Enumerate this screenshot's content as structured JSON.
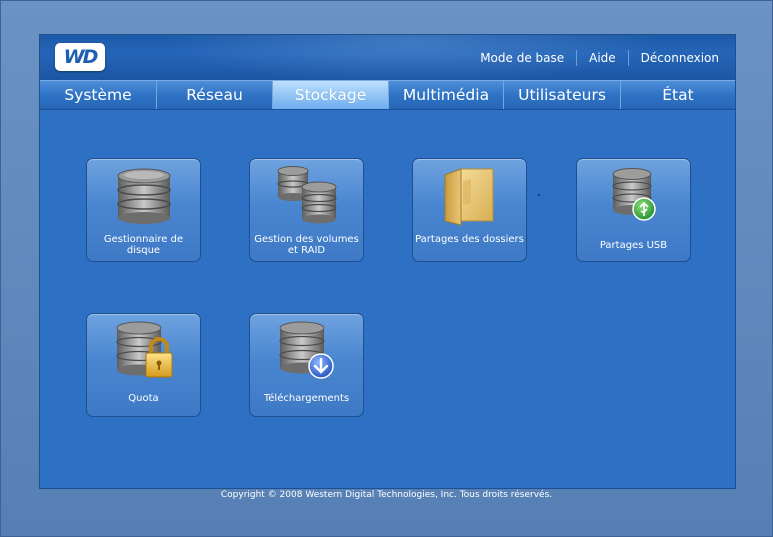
{
  "header": {
    "logo_text": "WD",
    "links": [
      "Mode de base",
      "Aide",
      "Déconnexion"
    ]
  },
  "nav": {
    "tabs": [
      "Système",
      "Réseau",
      "Stockage",
      "Multimédia",
      "Utilisateurs",
      "État"
    ],
    "active": "Stockage"
  },
  "tiles": [
    {
      "label": "Gestionnaire de disque",
      "icon": "disk-stack-icon"
    },
    {
      "label": "Gestion des volumes et RAID",
      "icon": "multi-disk-icon"
    },
    {
      "label": "Partages des dossiers",
      "icon": "folder-icon"
    },
    {
      "label": "Partages USB",
      "icon": "usb-disk-icon"
    },
    {
      "label": "Quota",
      "icon": "lock-disk-icon"
    },
    {
      "label": "Téléchargements",
      "icon": "download-disk-icon"
    }
  ],
  "footer": {
    "copyright": "Copyright © 2008 Western Digital Technologies, Inc. Tous droits réservés."
  },
  "colors": {
    "page_background": "#5b86ba",
    "panel_background": "#2e70c4",
    "header_background": "#1d5aa8",
    "active_tab": "#8ec3f4",
    "tile_background": "#4a86d0",
    "text": "#ffffff"
  }
}
